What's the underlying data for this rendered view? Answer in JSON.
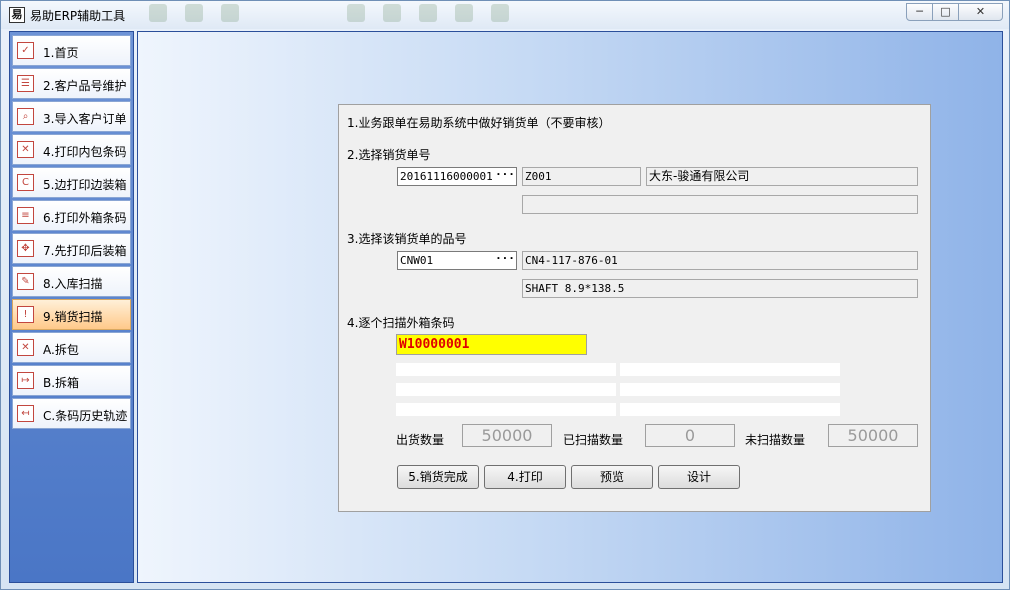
{
  "window": {
    "icon_glyph": "易",
    "title": "易助ERP辅助工具",
    "controls": {
      "minimize": "─",
      "maximize": "□",
      "close": "✕"
    }
  },
  "sidebar": {
    "items": [
      {
        "label": "1.首页",
        "icon": "check-icon",
        "glyph": "✓",
        "active": false
      },
      {
        "label": "2.客户品号维护",
        "icon": "list-icon",
        "glyph": "☰",
        "active": false
      },
      {
        "label": "3.导入客户订单",
        "icon": "search-icon",
        "glyph": "⌕",
        "active": false
      },
      {
        "label": "4.打印内包条码",
        "icon": "x-box-icon",
        "glyph": "✕",
        "active": false
      },
      {
        "label": "5.边打印边装箱",
        "icon": "box-c-icon",
        "glyph": "C",
        "active": false
      },
      {
        "label": "6.打印外箱条码",
        "icon": "printer-icon",
        "glyph": "≡",
        "active": false
      },
      {
        "label": "7.先打印后装箱",
        "icon": "move-icon",
        "glyph": "✥",
        "active": false
      },
      {
        "label": "8.入库扫描",
        "icon": "pen-icon",
        "glyph": "✎",
        "active": false
      },
      {
        "label": "9.销货扫描",
        "icon": "alert-icon",
        "glyph": "!",
        "active": true
      },
      {
        "label": "A.拆包",
        "icon": "x-box-icon",
        "glyph": "✕",
        "active": false
      },
      {
        "label": "B.拆箱",
        "icon": "expand-arrow-icon",
        "glyph": "↦",
        "active": false
      },
      {
        "label": "C.条码历史轨迹",
        "icon": "collapse-arrow-icon",
        "glyph": "↤",
        "active": false
      }
    ]
  },
  "panel": {
    "step1": "1.业务跟单在易助系统中做好销货单（不要审核）",
    "step2": "2.选择销货单号",
    "order_no": "20161116000001",
    "customer_code": "Z001",
    "customer_name": "大东-骏通有限公司",
    "order_note": "",
    "step3": "3.选择该销货单的品号",
    "item_no": "CNW01",
    "item_code": "CN4-117-876-01",
    "item_spec": "SHAFT 8.9*138.5",
    "step4": "4.逐个扫描外箱条码",
    "scan_value": "W10000001",
    "ellipsis": "···",
    "counts": {
      "shipped_label": "出货数量",
      "shipped_value": "50000",
      "scanned_label": "已扫描数量",
      "scanned_value": "0",
      "unscanned_label": "未扫描数量",
      "unscanned_value": "50000"
    },
    "buttons": {
      "complete": "5.销货完成",
      "print": "4.打印",
      "preview": "预览",
      "design": "设计"
    }
  },
  "colors": {
    "sidebar_bg": "#4a76c6",
    "active_item": "#ffc98a",
    "scan_bg": "#ffff00",
    "scan_text": "#e00000"
  }
}
